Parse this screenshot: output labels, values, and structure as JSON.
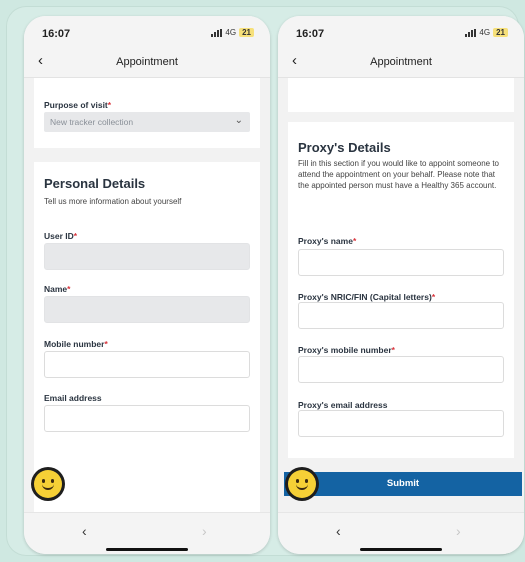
{
  "left": {
    "time": "16:07",
    "network": "4G",
    "battery": "21",
    "nav_title": "Appointment",
    "purpose_label": "Purpose of visit",
    "purpose_value": "New tracker collection",
    "personal_title": "Personal Details",
    "personal_subtitle": "Tell us more information about yourself",
    "user_id_label": "User ID",
    "name_label": "Name",
    "mobile_label": "Mobile number",
    "email_label": "Email address"
  },
  "right": {
    "time": "16:07",
    "network": "4G",
    "battery": "21",
    "nav_title": "Appointment",
    "proxy_title": "Proxy's Details",
    "proxy_desc": "Fill in this section if you would like to appoint someone to attend the appointment on your behalf. Please note that the appointed person must have a Healthy 365 account.",
    "proxy_name_label": "Proxy's name",
    "proxy_nric_label": "Proxy's NRIC/FIN (Capital letters)",
    "proxy_mobile_label": "Proxy's mobile number",
    "proxy_email_label": "Proxy's email address",
    "submit_label": "Submit"
  },
  "common": {
    "required_mark": "*",
    "back_glyph": "‹",
    "chevron_glyph": "⌄",
    "nav_back_glyph": "‹",
    "nav_forward_glyph": "›"
  },
  "colors": {
    "background": "#cfe8e1",
    "submit": "#1463a3",
    "required": "#d9343c",
    "smiley": "#f6d036"
  }
}
